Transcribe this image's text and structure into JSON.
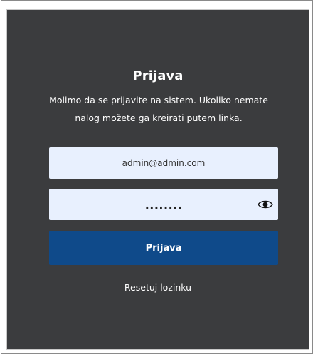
{
  "login": {
    "title": "Prijava",
    "subtitle": "Molimo da se prijavite na sistem. Ukoliko nemate nalog možete ga kreirati putem linka.",
    "email_value": "admin@admin.com",
    "password_value": "........",
    "submit_label": "Prijava",
    "reset_link": "Resetuj lozinku",
    "eye_icon": "eye-icon"
  },
  "colors": {
    "panel_bg": "#3b3c3e",
    "input_bg": "#e8f0fe",
    "button_bg": "#0f4a8a",
    "text": "#ffffff"
  }
}
